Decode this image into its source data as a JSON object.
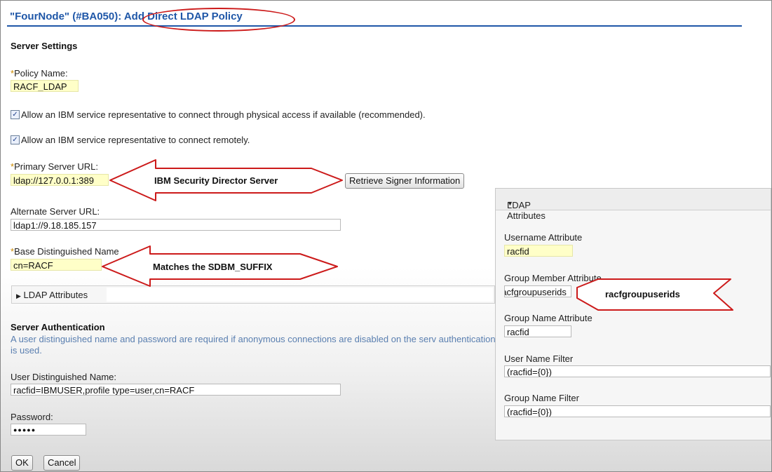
{
  "header": {
    "title": "\"FourNode\" (#BA050): Add Direct LDAP Policy"
  },
  "server_settings": {
    "heading": "Server Settings",
    "policy_name_label": "Policy Name:",
    "policy_name_value": "RACF_LDAP",
    "checkbox_physical_label": "Allow an IBM service representative to connect through physical access if available (recommended).",
    "checkbox_remote_label": "Allow an IBM service representative to connect remotely.",
    "primary_url_label": "Primary Server URL:",
    "primary_url_value": "ldap://127.0.0.1:389",
    "retrieve_signer_button": "Retrieve Signer Information",
    "alternate_url_label": "Alternate Server URL:",
    "alternate_url_value": "ldap1://9.18.185.157",
    "base_dn_label": "Base Distinguished Name",
    "base_dn_value": "cn=RACF",
    "ldap_attributes_collapsed": "LDAP Attributes"
  },
  "server_auth": {
    "heading": "Server Authentication",
    "description": "A user distinguished name and password are required if anonymous connections are disabled on the serv authentication is used.",
    "user_dn_label": "User Distinguished Name:",
    "user_dn_value": "racfid=IBMUSER,profile type=user,cn=RACF",
    "password_label": "Password:",
    "password_value": "●●●●●"
  },
  "buttons": {
    "ok": "OK",
    "cancel": "Cancel"
  },
  "ldap_panel": {
    "title": "LDAP Attributes",
    "username_attr_label": "Username Attribute",
    "username_attr_value": "racfid",
    "group_member_label": "Group Member Attribute",
    "group_member_value": "racfgroupuserids",
    "group_name_label": "Group Name Attribute",
    "group_name_value": "racfid",
    "user_filter_label": "User Name Filter",
    "user_filter_value": "(racfid={0})",
    "group_filter_label": "Group Name Filter",
    "group_filter_value": "(racfid={0})"
  },
  "annotations": {
    "security_server": "IBM Security Director Server",
    "sdbm_suffix": "Matches the SDBM_SUFFIX",
    "group_userids": "racfgroupuserids"
  },
  "colors": {
    "title_blue": "#1f57a8",
    "annotation_red": "#cc1a1a",
    "required_field_bg": "#ffffc8"
  }
}
